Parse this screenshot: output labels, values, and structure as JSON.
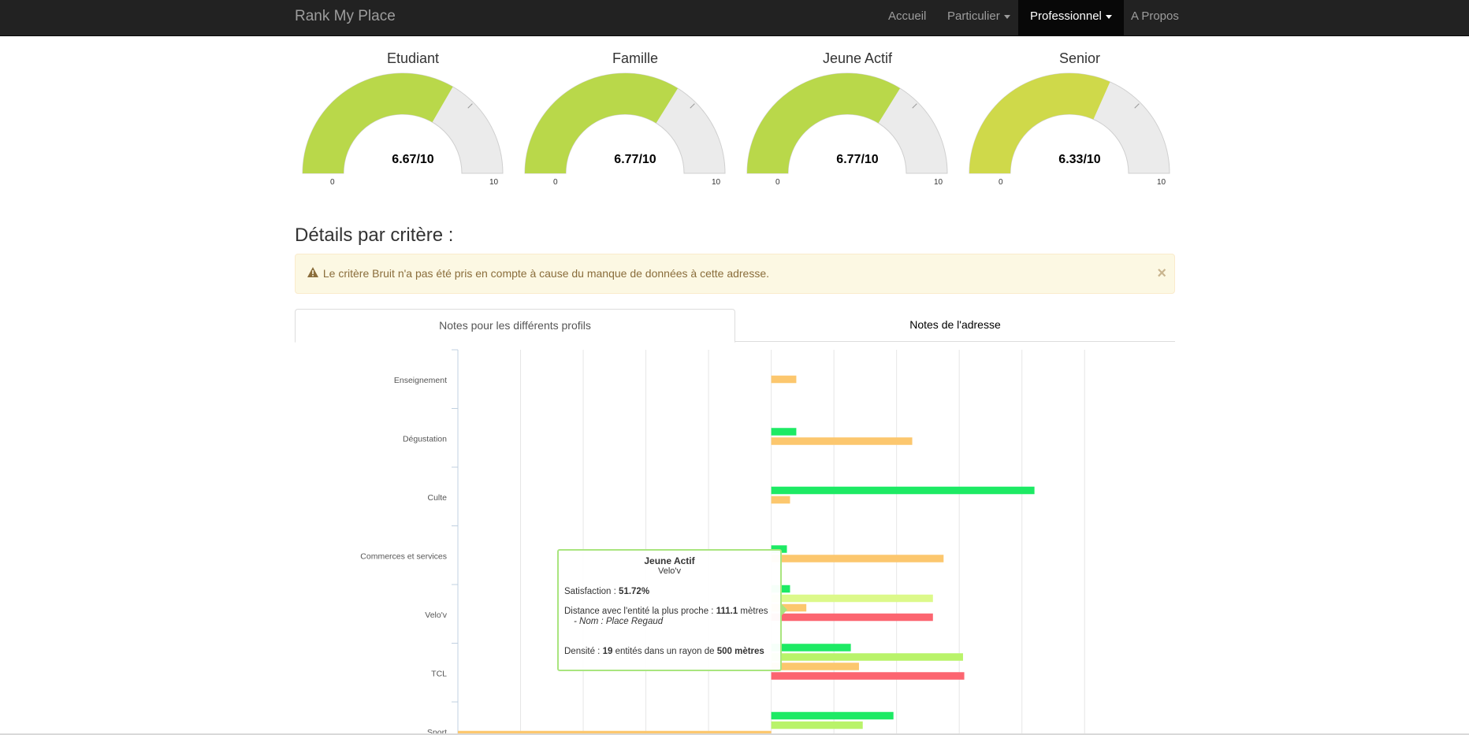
{
  "navbar": {
    "brand": "Rank My Place",
    "items": [
      {
        "label": "Accueil"
      },
      {
        "label": "Particulier"
      },
      {
        "label": "Professionnel"
      },
      {
        "label": "A Propos"
      }
    ]
  },
  "gauges": [
    {
      "title": "Etudiant",
      "value": 6.67,
      "value_label": "6.67/10",
      "min": "0",
      "max": "10",
      "color": "#b9d84a"
    },
    {
      "title": "Famille",
      "value": 6.77,
      "value_label": "6.77/10",
      "min": "0",
      "max": "10",
      "color": "#b9d84a"
    },
    {
      "title": "Jeune Actif",
      "value": 6.77,
      "value_label": "6.77/10",
      "min": "0",
      "max": "10",
      "color": "#b9d84a"
    },
    {
      "title": "Senior",
      "value": 6.33,
      "value_label": "6.33/10",
      "min": "0",
      "max": "10",
      "color": "#cfd94a"
    }
  ],
  "section_title": "Détails par critère :",
  "alert": {
    "text": "Le critère Bruit n'a pas été pris en compte à cause du manque de données à cette adresse.",
    "close": "×",
    "icon": "warning-icon"
  },
  "tabs": [
    {
      "label": "Notes pour les différents profils"
    },
    {
      "label": "Notes de l'adresse"
    }
  ],
  "colors": {
    "green": "#1dea64",
    "lightgreen": "#b9f36a",
    "yellowgreen": "#dcf98a",
    "orange": "#fcc76e",
    "red": "#fc6570",
    "tooltip_border": "#a9e57f"
  },
  "chart_data": {
    "type": "bar",
    "orientation": "horizontal",
    "categories": [
      "Enseignement",
      "Dégustation",
      "Culte",
      "Commerces et services",
      "Velo'v",
      "TCL",
      "Sport"
    ],
    "xlim": [
      -50,
      55
    ],
    "grid": true,
    "series": [
      {
        "color": "#1dea64",
        "values": [
          null,
          4,
          42,
          2.5,
          3,
          12.7,
          19.5
        ]
      },
      {
        "color": "#dcf98a",
        "values": [
          null,
          null,
          null,
          null,
          25.8,
          null,
          null
        ]
      },
      {
        "color": "#b9f36a",
        "values": [
          null,
          null,
          null,
          null,
          null,
          30.6,
          14.6
        ]
      },
      {
        "color": "#fcc76e",
        "values": [
          4,
          22.5,
          3,
          27.5,
          5.6,
          14,
          -50
        ]
      },
      {
        "color": "#fc6570",
        "values": [
          null,
          null,
          null,
          null,
          25.8,
          30.8,
          null
        ]
      }
    ]
  },
  "tooltip": {
    "title": "Jeune Actif",
    "subtitle": "Velo'v",
    "satisfaction_label": "Satisfaction : ",
    "satisfaction_value": "51.72%",
    "distance_label": "Distance avec l'entité la plus proche : ",
    "distance_value": "111.1",
    "distance_unit": " mètres",
    "nom": "- Nom : Place Regaud",
    "densite_label": "Densité : ",
    "densite_count": "19",
    "densite_mid": " entités dans un rayon de ",
    "densite_radius": "500 mètres"
  }
}
